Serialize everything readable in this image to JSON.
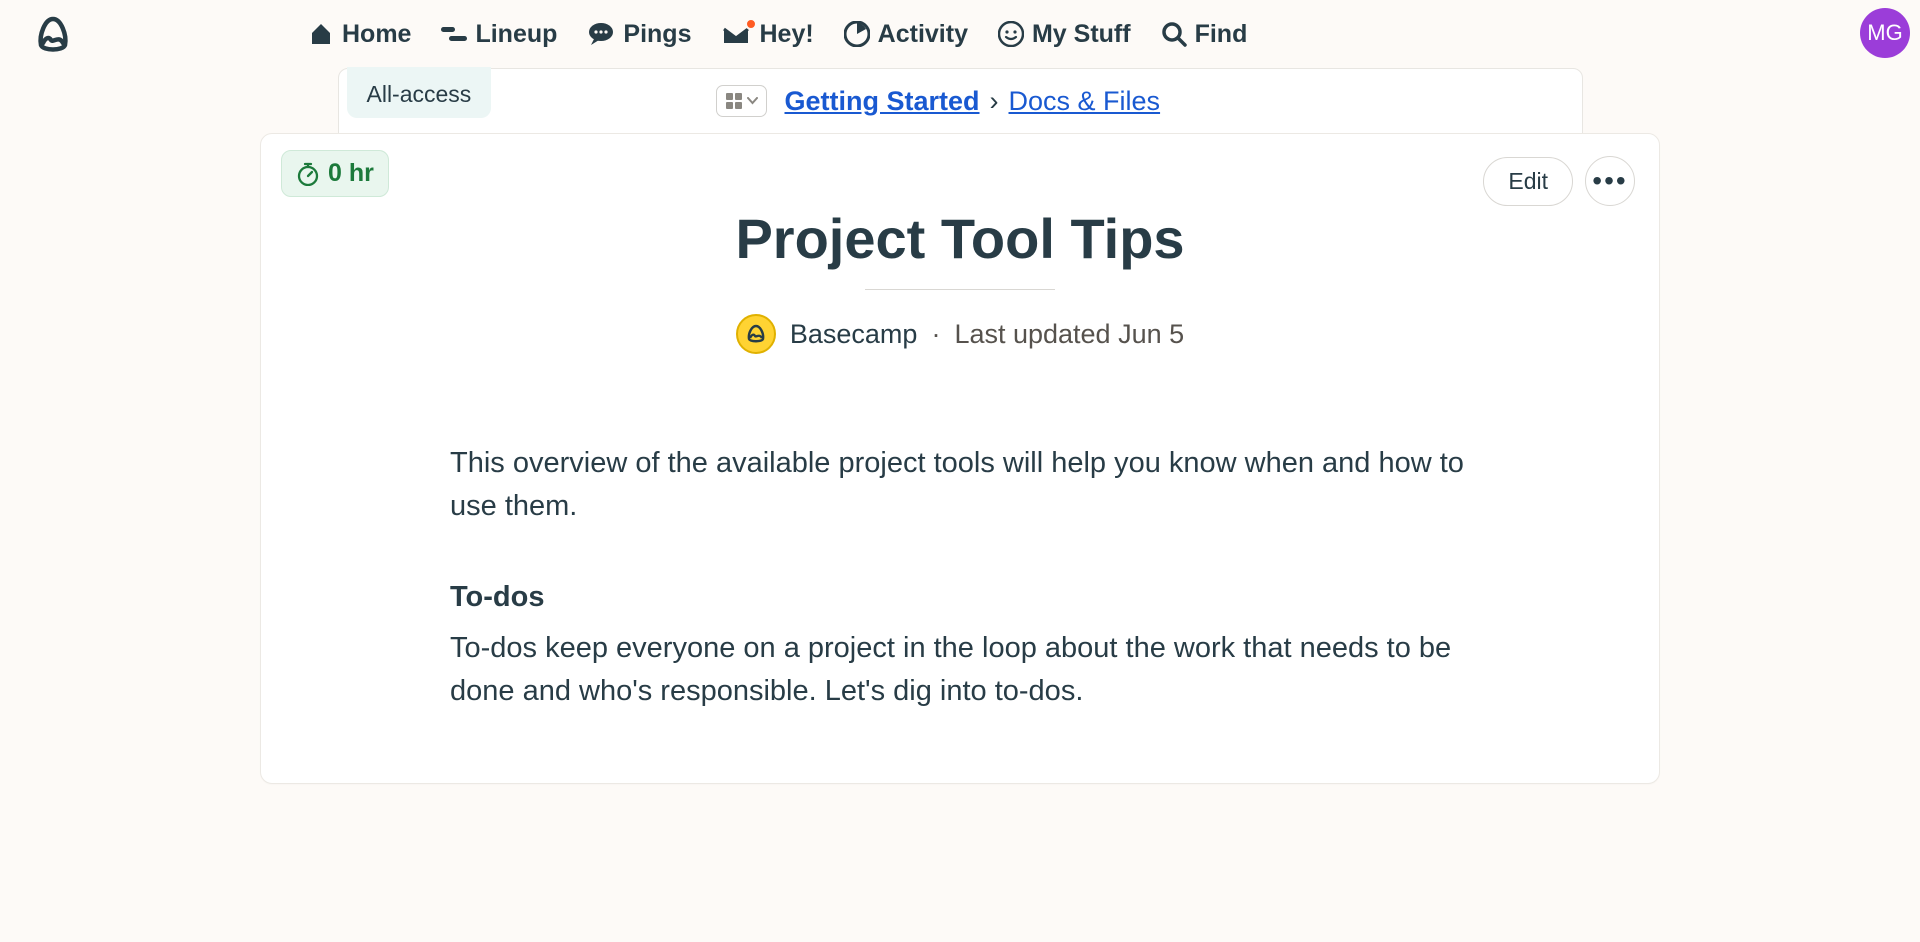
{
  "nav": {
    "items": [
      {
        "label": "Home"
      },
      {
        "label": "Lineup"
      },
      {
        "label": "Pings"
      },
      {
        "label": "Hey!"
      },
      {
        "label": "Activity"
      },
      {
        "label": "My Stuff"
      },
      {
        "label": "Find"
      }
    ]
  },
  "avatar_initials": "MG",
  "all_access_label": "All-access",
  "breadcrumb": {
    "project": "Getting Started",
    "separator": "›",
    "section": "Docs & Files"
  },
  "timer_label": "0 hr",
  "actions": {
    "edit": "Edit"
  },
  "document": {
    "title": "Project Tool Tips",
    "author": "Basecamp",
    "dot": "·",
    "updated": "Last updated Jun 5",
    "intro": "This overview of the available project tools will help you know when and how to use them.",
    "section1_heading": "To-dos",
    "section1_body": "To-dos keep everyone on a project in the loop about the work that needs to be done and who's responsible. Let's dig into to-dos."
  }
}
